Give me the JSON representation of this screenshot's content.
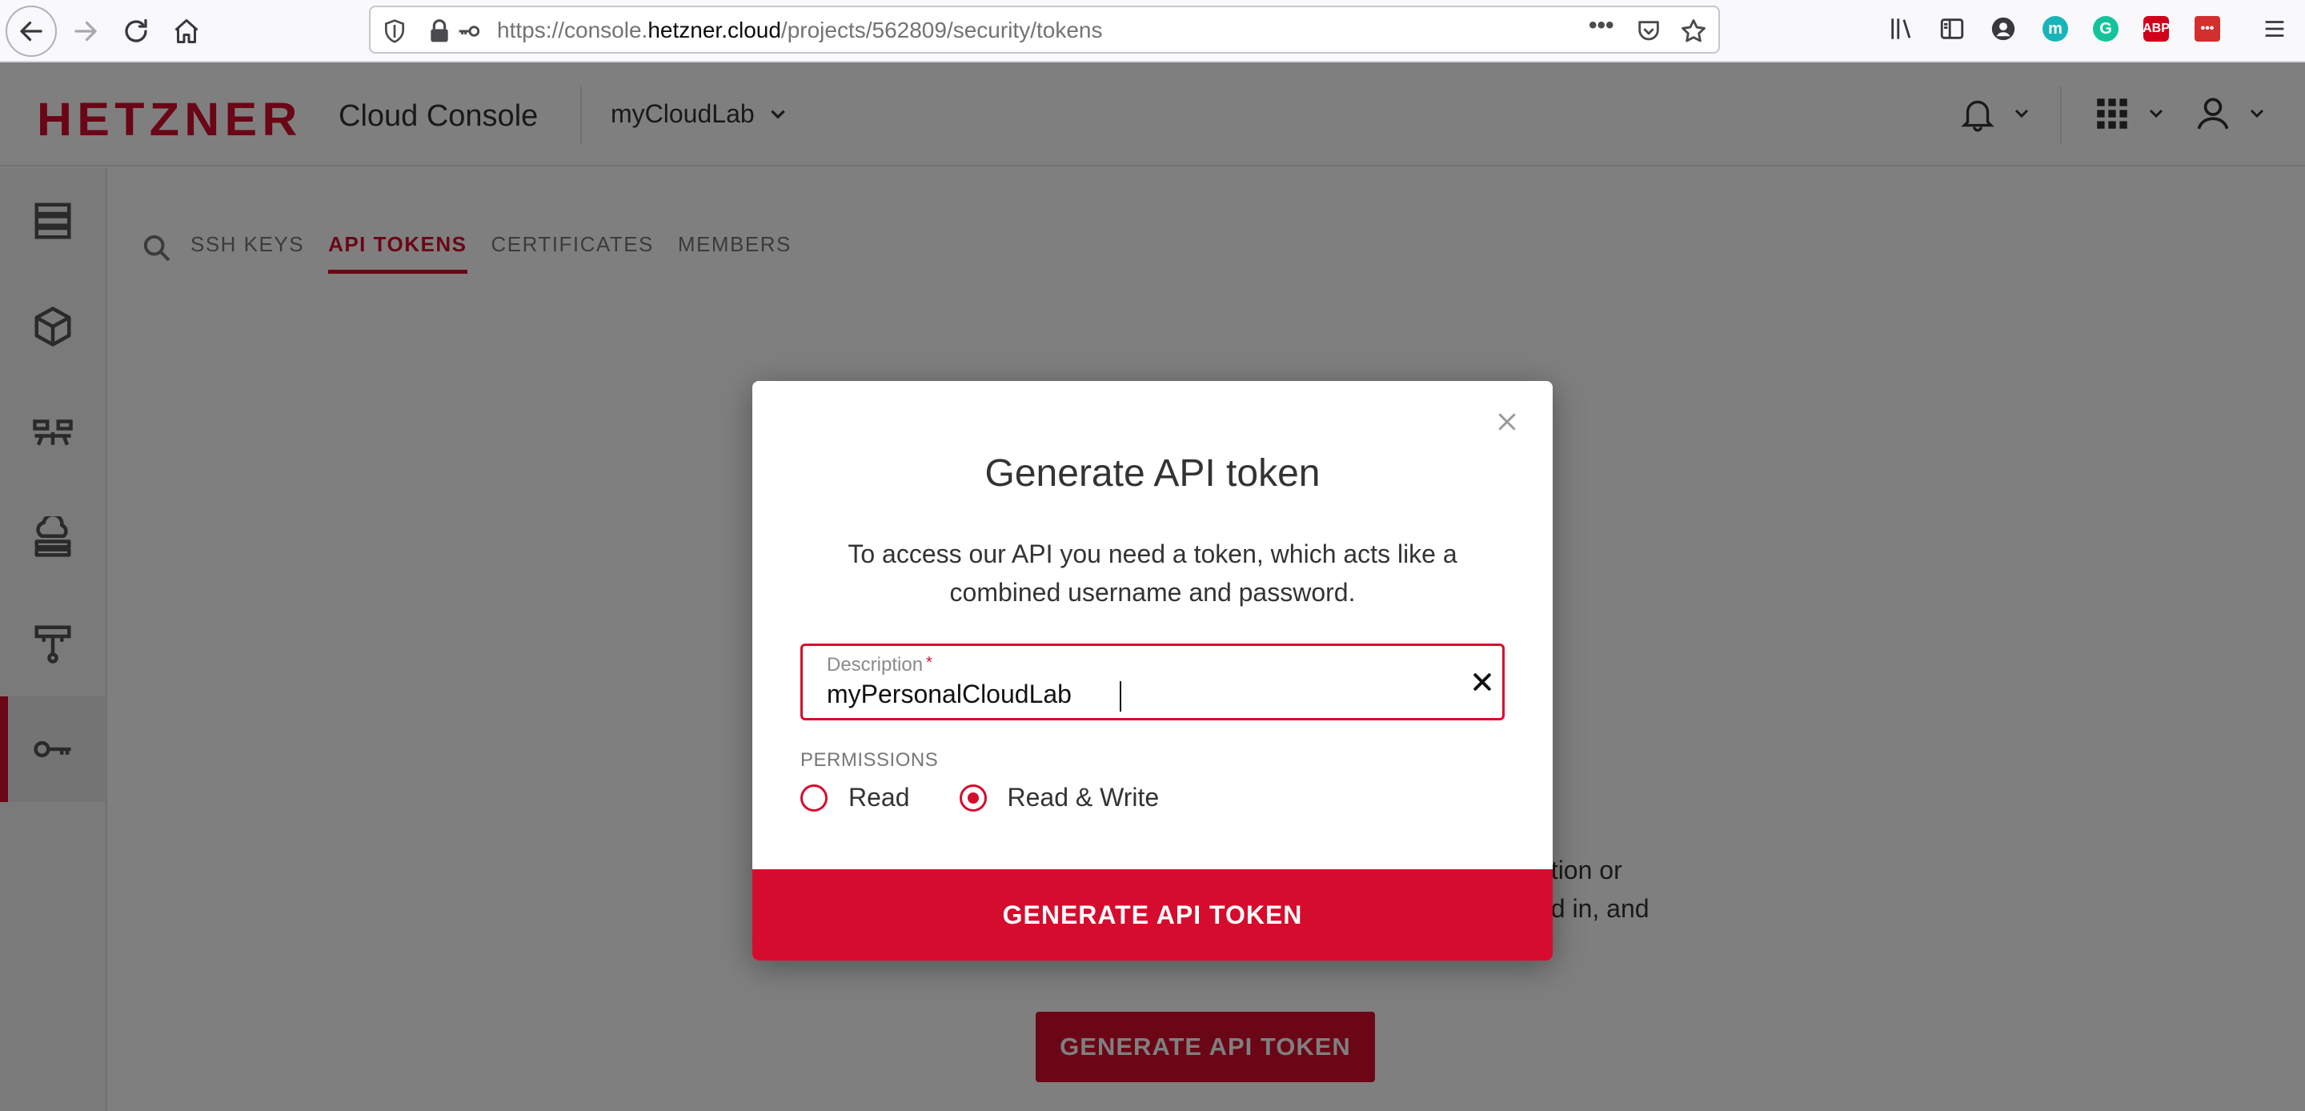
{
  "browser": {
    "url_prefix": "https://console.",
    "url_host": "hetzner.cloud",
    "url_path": "/projects/562809/security/tokens",
    "ellipsis": "•••",
    "extensions": [
      {
        "name": "m",
        "color": "#17b5b9"
      },
      {
        "name": "G",
        "color": "#15c39a"
      },
      {
        "name": "ABP",
        "color": "#d0021b"
      },
      {
        "name": "•••",
        "color": "#d32f2f"
      }
    ]
  },
  "header": {
    "logo": "HETZNER",
    "product": "Cloud Console",
    "project": "myCloudLab"
  },
  "sidebar": {
    "items": [
      {
        "name": "servers"
      },
      {
        "name": "volumes"
      },
      {
        "name": "load-balancers"
      },
      {
        "name": "floating-ips"
      },
      {
        "name": "networks"
      },
      {
        "name": "security"
      }
    ],
    "active": "security"
  },
  "tabs": [
    {
      "label": "SSH KEYS",
      "active": false
    },
    {
      "label": "API TOKENS",
      "active": true
    },
    {
      "label": "CERTIFICATES",
      "active": false
    },
    {
      "label": "MEMBERS",
      "active": false
    }
  ],
  "background": {
    "text_line1": "ation or",
    "text_line2": "ed in, and",
    "cta": "GENERATE API TOKEN"
  },
  "modal": {
    "title": "Generate API token",
    "description": "To access our API you need a token, which acts like a combined username and password.",
    "field_label": "Description",
    "required_mark": "*",
    "field_value": "myPersonalCloudLab",
    "permissions_label": "PERMISSIONS",
    "options": [
      {
        "label": "Read",
        "checked": false
      },
      {
        "label": "Read & Write",
        "checked": true
      }
    ],
    "cta": "GENERATE API TOKEN"
  },
  "colors": {
    "brand": "#d50c2d"
  }
}
